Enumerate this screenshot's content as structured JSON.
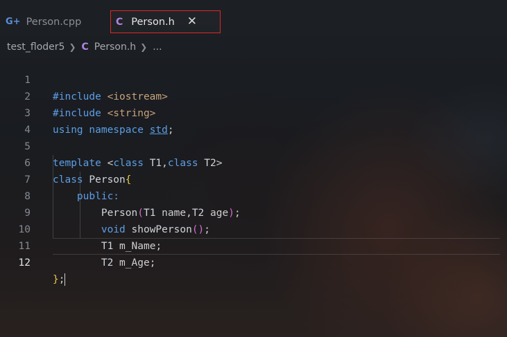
{
  "tabs": [
    {
      "label": "Person.cpp",
      "icon": "cpp-file-icon",
      "active": false
    },
    {
      "label": "Person.h",
      "icon": "c-header-file-icon",
      "active": true,
      "close": "✕"
    }
  ],
  "breadcrumb": {
    "folder": "test_floder5",
    "file": "Person.h",
    "more": "..."
  },
  "editor": {
    "active_line": 12,
    "lines": [
      {
        "n": "1"
      },
      {
        "n": "2"
      },
      {
        "n": "3"
      },
      {
        "n": "4"
      },
      {
        "n": "5"
      },
      {
        "n": "6"
      },
      {
        "n": "7"
      },
      {
        "n": "8"
      },
      {
        "n": "9"
      },
      {
        "n": "10"
      },
      {
        "n": "11"
      },
      {
        "n": "12"
      }
    ],
    "tokens": {
      "include": "#include",
      "iostream": "<iostream>",
      "string": "<string>",
      "using": "using",
      "namespace": "namespace",
      "std": "std",
      "semi": ";",
      "template": "template",
      "lt": "<",
      "class": "class",
      "t1": "T1",
      "comma": ",",
      "t2": "T2",
      "gt": ">",
      "person": "Person",
      "lbrace": "{",
      "public": "public:",
      "lparen": "(",
      "name": "name",
      "age": "age",
      "rparen": ")",
      "void": "void",
      "showPerson": "showPerson",
      "mname": "m_Name",
      "mage": "m_Age",
      "rbrace": "}"
    }
  },
  "colors": {
    "active_tab_border": "#e0262a",
    "keyword": "#5c9ee6",
    "c_icon": "#b184e0"
  }
}
